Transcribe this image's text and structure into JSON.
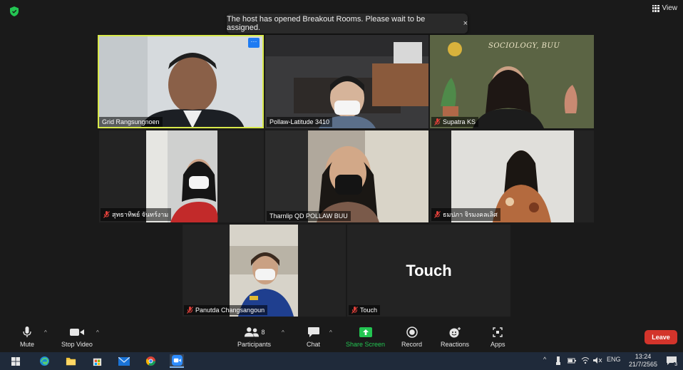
{
  "window": {
    "view_label": "View"
  },
  "toast": {
    "message": "The host has opened Breakout Rooms. Please wait to be assigned.",
    "close": "×"
  },
  "participants": [
    {
      "name": "Grid Rangsungnoen",
      "muted": false,
      "active_speaker": true
    },
    {
      "name": "Pollaw-Latitude 3410",
      "muted": false,
      "active_speaker": false
    },
    {
      "name": "Supatra KS",
      "muted": true,
      "active_speaker": false
    },
    {
      "name": "สุทธาทิพย์ จันทร์งาม",
      "muted": true,
      "active_speaker": false
    },
    {
      "name": "Tharnlip QD POLLAW BUU",
      "muted": false,
      "active_speaker": false
    },
    {
      "name": "ธมปภา จิรมงคลเลิศ",
      "muted": true,
      "active_speaker": false
    },
    {
      "name": "Panutda Changsangoun",
      "muted": true,
      "active_speaker": false
    },
    {
      "name": "Touch",
      "muted": true,
      "active_speaker": false,
      "avatar_text": "Touch"
    }
  ],
  "tile_overlay": {
    "sociology_text": "SOCIOLOGY, BUU",
    "more_button": "···"
  },
  "toolbar": {
    "mute": "Mute",
    "stop_video": "Stop Video",
    "participants": "Participants",
    "participants_count": "8",
    "chat": "Chat",
    "share_screen": "Share Screen",
    "record": "Record",
    "reactions": "Reactions",
    "apps": "Apps",
    "leave": "Leave"
  },
  "taskbar": {
    "language": "ENG",
    "time": "13:24",
    "date": "21/7/2565",
    "notification_count": "3"
  },
  "colors": {
    "active_speaker_border": "#d8e94a",
    "share_green": "#23c552",
    "leave_red": "#d3342b",
    "muted_red": "#e0403a"
  }
}
